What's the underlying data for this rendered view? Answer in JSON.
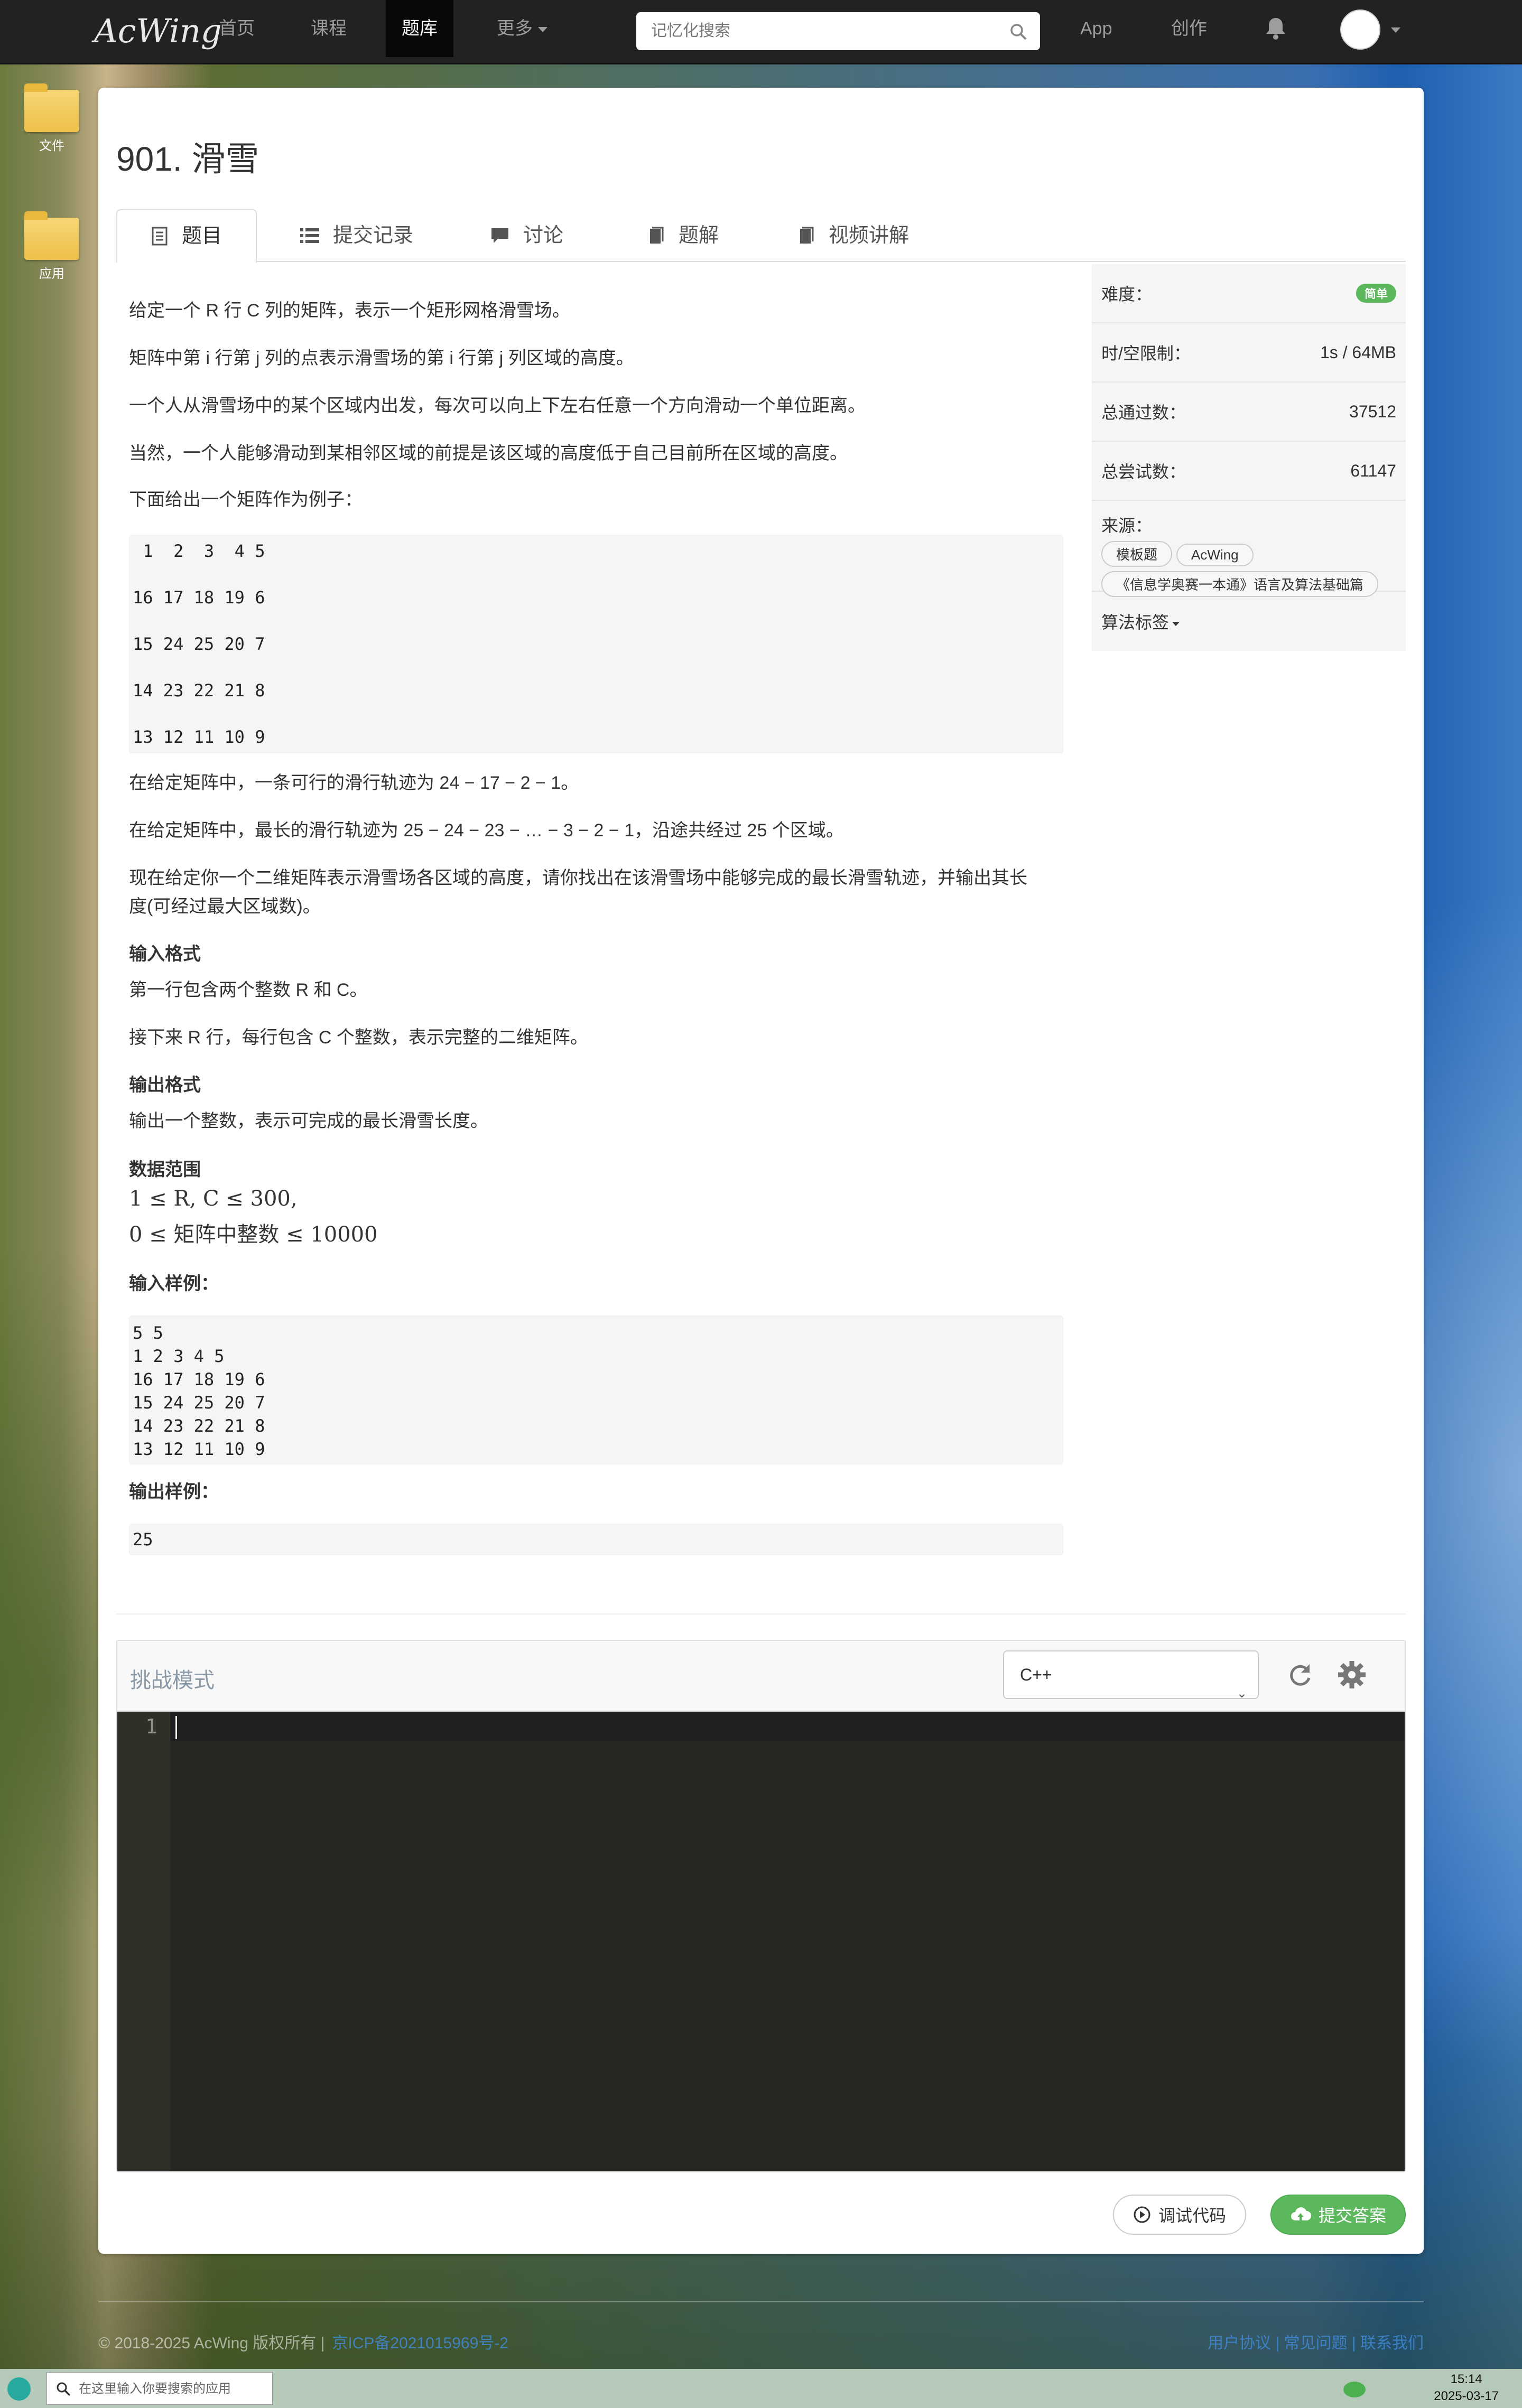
{
  "nav": {
    "logo": "AcWing",
    "items": [
      "首页",
      "课程",
      "题库",
      "更多",
      "App",
      "创作"
    ],
    "active": "题库",
    "search_placeholder": "记忆化搜索"
  },
  "desktop": {
    "icons": [
      "文件",
      "应用"
    ]
  },
  "problem": {
    "title": "901. 滑雪",
    "tabs": [
      "题目",
      "提交记录",
      "讨论",
      "题解",
      "视频讲解"
    ],
    "desc": [
      "给定一个 R 行 C 列的矩阵，表示一个矩形网格滑雪场。",
      "矩阵中第 i 行第 j 列的点表示滑雪场的第 i 行第 j 列区域的高度。",
      "一个人从滑雪场中的某个区域内出发，每次可以向上下左右任意一个方向滑动一个单位距离。",
      "当然，一个人能够滑动到某相邻区域的前提是该区域的高度低于自己目前所在区域的高度。",
      "下面给出一个矩阵作为例子："
    ],
    "example_matrix": [
      " 1  2  3  4 5",
      " ",
      "16 17 18 19 6",
      " ",
      "15 24 25 20 7",
      " ",
      "14 23 22 21 8",
      " ",
      "13 12 11 10 9"
    ],
    "after": [
      "在给定矩阵中，一条可行的滑行轨迹为 24 − 17 − 2 − 1。",
      "在给定矩阵中，最长的滑行轨迹为 25 − 24 − 23 − … − 3 − 2 − 1，沿途共经过 25 个区域。",
      "现在给定你一个二维矩阵表示滑雪场各区域的高度，请你找出在该滑雪场中能够完成的最长滑雪轨迹，并输出其长",
      "度(可经过最大区域数)。"
    ],
    "input_format_title": "输入格式",
    "input_format": [
      "第一行包含两个整数 R 和 C。",
      "接下来 R 行，每行包含 C 个整数，表示完整的二维矩阵。"
    ],
    "output_format_title": "输出格式",
    "output_format": "输出一个整数，表示可完成的最长滑雪长度。",
    "range_title": "数据范围",
    "range": [
      "1 ≤ R, C ≤ 300,",
      "0 ≤ 矩阵中整数 ≤ 10000"
    ],
    "sample_in_title": "输入样例：",
    "sample_in": "5 5\n1 2 3 4 5\n16 17 18 19 6\n15 24 25 20 7\n14 23 22 21 8\n13 12 11 10 9",
    "sample_out_title": "输出样例：",
    "sample_out": "25"
  },
  "sidebar": {
    "difficulty_label": "难度：",
    "difficulty": "简单",
    "limit_label": "时/空限制：",
    "limit": "1s / 64MB",
    "passed_label": "总通过数：",
    "passed": "37512",
    "tried_label": "总尝试数：",
    "tried": "61147",
    "source_label": "来源：",
    "source_tags": [
      "模板题",
      "AcWing",
      "《信息学奥赛一本通》语言及算法基础篇"
    ],
    "algo_label": "算法标签"
  },
  "editor": {
    "mode": "挑战模式",
    "language": "C++",
    "line": "1"
  },
  "buttons": {
    "debug": "调试代码",
    "submit": "提交答案"
  },
  "footer": {
    "copyright": "© 2018-2025 AcWing 版权所有  |",
    "icp": "京ICP备2021015969号-2",
    "right": "用户协议 | 常见问题 | 联系我们"
  },
  "taskbar": {
    "search_placeholder": "在这里输入你要搜索的应用",
    "time": "15:14",
    "date": "2025-03-17"
  }
}
